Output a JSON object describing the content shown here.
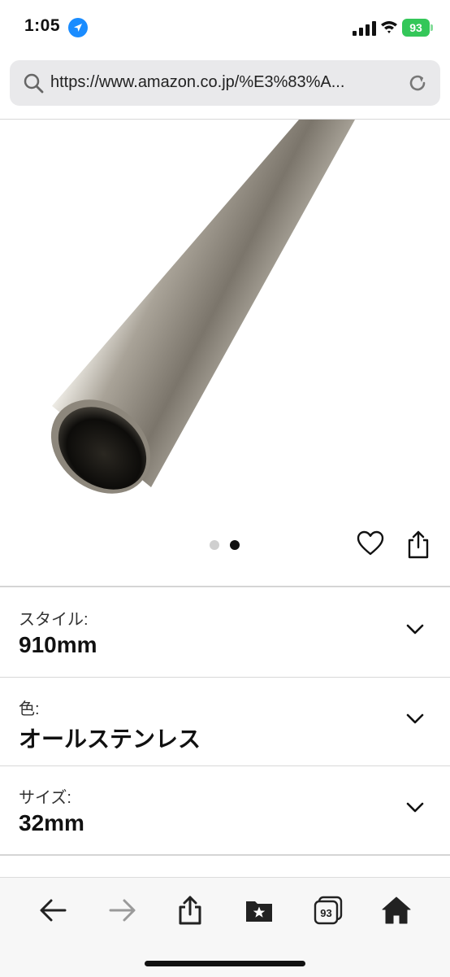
{
  "status_bar": {
    "time": "1:05",
    "battery": "93"
  },
  "browser": {
    "url": "https://www.amazon.co.jp/%E3%83%A..."
  },
  "product": {
    "image_count": 2,
    "active_image_index": 1
  },
  "variants": [
    {
      "label": "スタイル:",
      "value": "910mm"
    },
    {
      "label": "色:",
      "value": "オールステンレス"
    },
    {
      "label": "サイズ:",
      "value": "32mm"
    }
  ],
  "toolbar": {
    "tab_count": "93"
  },
  "colors": {
    "accent_blue": "#1a8cff",
    "battery_green": "#34c759",
    "url_bar_bg": "#e9e9eb"
  }
}
